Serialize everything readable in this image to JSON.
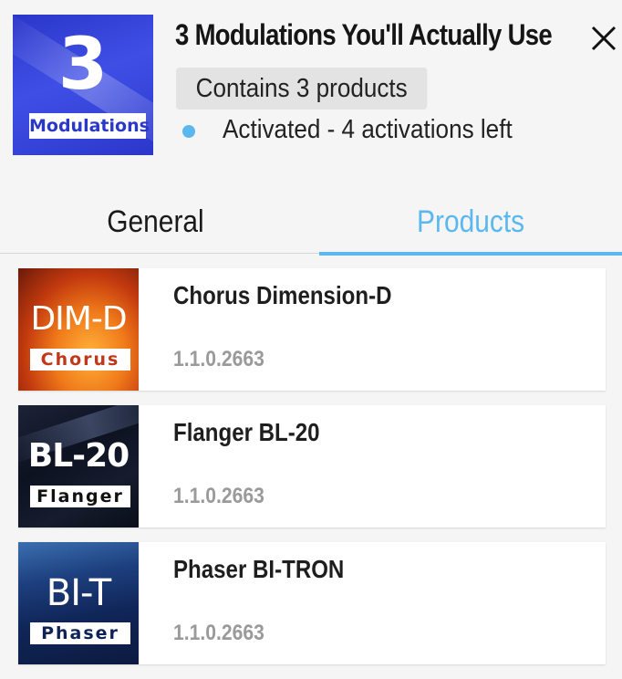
{
  "bundle": {
    "art_number": "3",
    "art_label": "Modulations",
    "title": "3 Modulations You'll Actually Use",
    "contents_chip": "Contains 3 products",
    "status_text": "Activated - 4 activations left",
    "status_color": "#5bb8ef"
  },
  "tabs": [
    {
      "label": "General",
      "active": false
    },
    {
      "label": "Products",
      "active": true
    }
  ],
  "accent_color": "#5bb8ef",
  "products": [
    {
      "name": "Chorus Dimension-D",
      "version": "1.1.0.2663",
      "art_title": "DIM-D",
      "art_label": "Chorus"
    },
    {
      "name": "Flanger BL-20",
      "version": "1.1.0.2663",
      "art_title": "BL-20",
      "art_label": "Flanger"
    },
    {
      "name": "Phaser BI-TRON",
      "version": "1.1.0.2663",
      "art_title": "BI-T",
      "art_label": "Phaser"
    }
  ]
}
